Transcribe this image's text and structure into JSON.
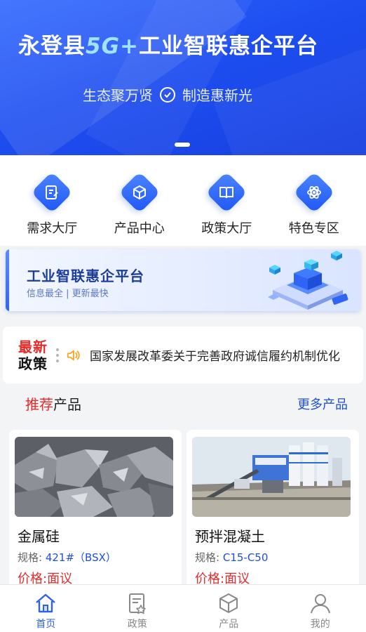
{
  "banner": {
    "title_pre": "永登县",
    "title_hl": "5G+",
    "title_post": "工业智联惠企平台",
    "sub_left": "生态聚万贤",
    "sub_right": "制造惠新光"
  },
  "quicknav": [
    {
      "label": "需求大厅",
      "icon": "demand-icon"
    },
    {
      "label": "产品中心",
      "icon": "product-cube-icon"
    },
    {
      "label": "政策大厅",
      "icon": "policy-book-icon"
    },
    {
      "label": "特色专区",
      "icon": "atom-icon"
    }
  ],
  "promo": {
    "title": "工业智联惠企平台",
    "sub": "信息最全 | 更新最快"
  },
  "news": {
    "logo_top": "最新",
    "logo_bottom": "政策",
    "text": "国家发展改革委关于完善政府诚信履约机制优化"
  },
  "section": {
    "title_red": "推荐",
    "title_rest": "产品",
    "more": "更多产品"
  },
  "products": [
    {
      "name": "金属硅",
      "spec_label": "规格:",
      "spec_value": "421#（BSX）",
      "price": "价格:面议"
    },
    {
      "name": "预拌混凝土",
      "spec_label": "规格:",
      "spec_value": "C15-C50",
      "price": "价格:面议"
    }
  ],
  "tabs": [
    {
      "label": "首页",
      "icon": "home-icon",
      "active": true
    },
    {
      "label": "政策",
      "icon": "policy-icon",
      "active": false
    },
    {
      "label": "产品",
      "icon": "cube-icon",
      "active": false
    },
    {
      "label": "我的",
      "icon": "user-icon",
      "active": false
    }
  ],
  "colors": {
    "brand": "#1e4ef0",
    "accent_red": "#e62a2a",
    "link_blue": "#1f4fd8"
  }
}
